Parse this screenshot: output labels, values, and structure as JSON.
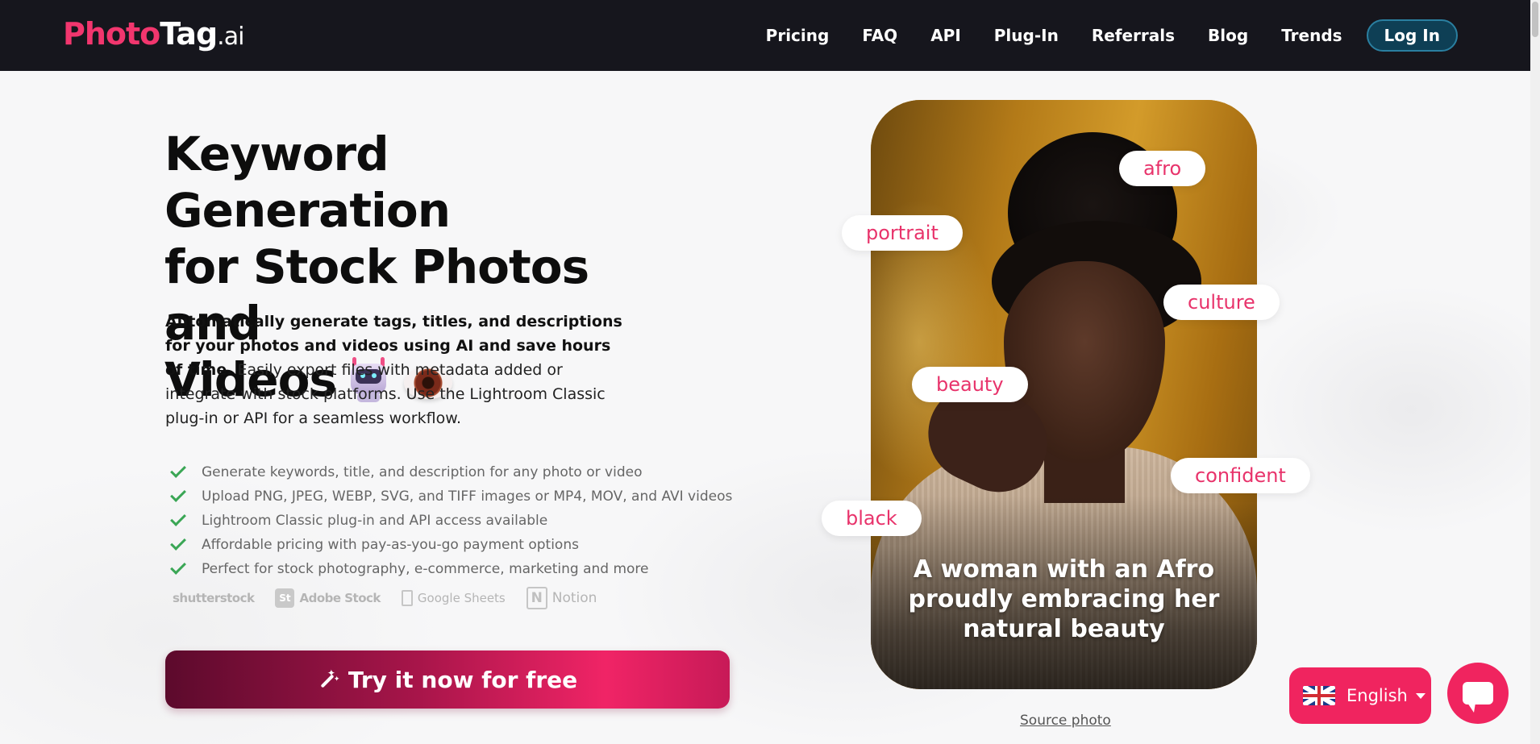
{
  "header": {
    "logo": {
      "part1": "Photo",
      "part2": "Tag",
      "part3": ".ai"
    },
    "nav": [
      "Pricing",
      "FAQ",
      "API",
      "Plug-In",
      "Referrals",
      "Blog",
      "Trends"
    ],
    "login_label": "Log In"
  },
  "hero": {
    "title_line1": "Keyword Generation",
    "title_line2": "for Stock Photos and",
    "title_line3": "Videos",
    "desc_bold": "Automatically generate tags, titles, and descriptions for your photos and videos using AI and save hours of time.",
    "desc_rest": "Easily export files with metadata added or integrate with stock platforms. Use the Lightroom Classic plug-in or API for a seamless workflow.",
    "features": [
      "Generate keywords, title, and description for any photo or video",
      "Upload PNG, JPEG, WEBP, SVG, and TIFF images or MP4, MOV, and AVI videos",
      "Lightroom Classic plug-in and API access available",
      "Affordable pricing with pay-as-you-go payment options",
      "Perfect for stock photography, e-commerce, marketing and more"
    ],
    "partners": {
      "shutterstock": "shutterstock",
      "adobe_badge": "St",
      "adobe": "Adobe Stock",
      "google": "Google Sheets",
      "notion_badge": "N",
      "notion": "Notion"
    },
    "cta_label": "Try it now for free"
  },
  "photo": {
    "caption": "A woman with an Afro proudly embracing her natural beauty",
    "tags": [
      "afro",
      "portrait",
      "culture",
      "beauty",
      "confident",
      "black"
    ],
    "source_label": "Source photo"
  },
  "floating": {
    "language": "English"
  },
  "colors": {
    "brand_pink": "#f0245f",
    "header_bg": "#16161d",
    "check_green": "#3aa655"
  }
}
